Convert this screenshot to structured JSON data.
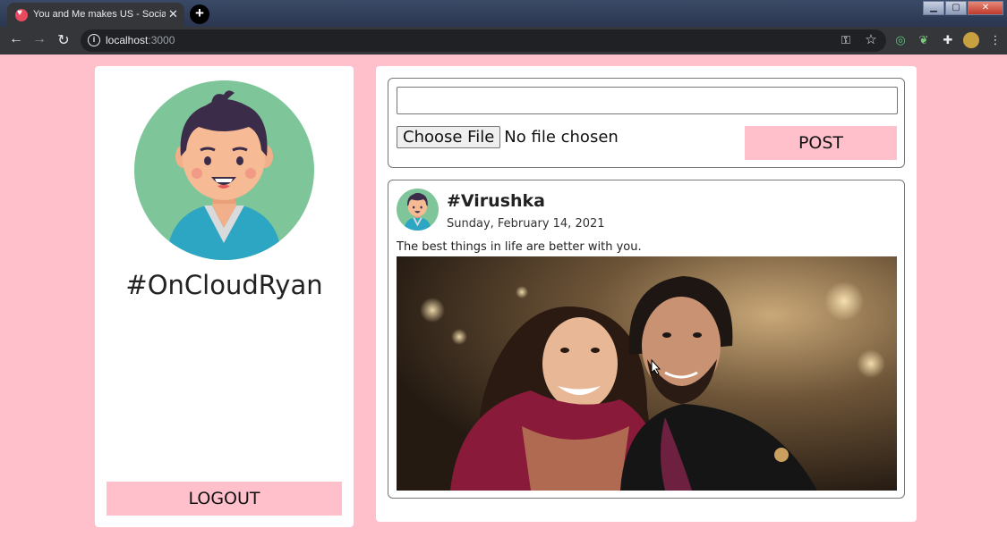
{
  "browser": {
    "tab_title": "You and Me makes US - Social N",
    "url_host": "localhost",
    "url_port": ":3000"
  },
  "profile": {
    "username": "#OnCloudRyan",
    "logout_label": "LOGOUT"
  },
  "composer": {
    "input_value": "",
    "choose_file_label": "Choose File",
    "file_status": "No file chosen",
    "post_label": "POST"
  },
  "post": {
    "title": "#Virushka",
    "date": "Sunday, February 14, 2021",
    "text": "The best things in life are better with you."
  },
  "icons": {
    "favicon": "heart-icon",
    "avatar": "boy-avatar-icon",
    "photo": "couple-photo"
  },
  "colors": {
    "page_background": "#ffc0cb",
    "button_background": "#ffc0cb",
    "avatar_background": "#7ec699",
    "card_background": "#ffffff"
  }
}
